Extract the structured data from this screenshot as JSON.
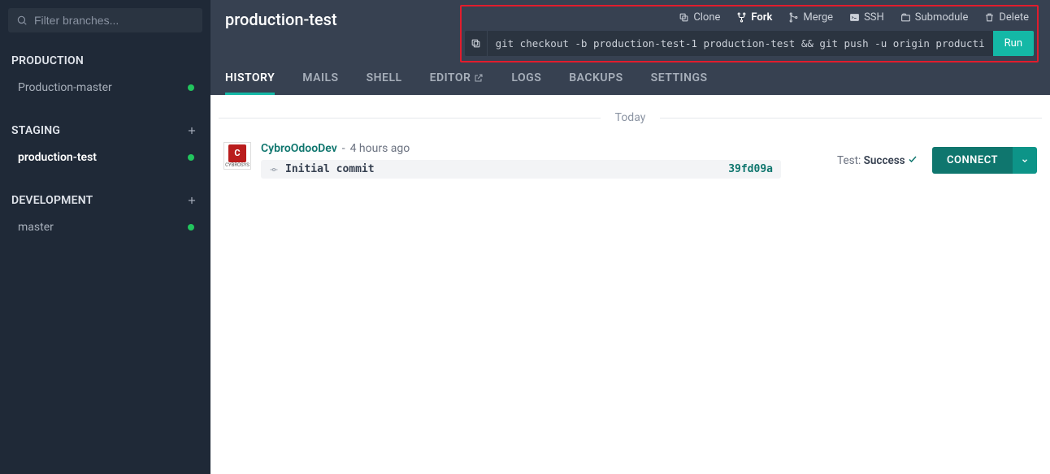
{
  "search": {
    "placeholder": "Filter branches..."
  },
  "sidebar": {
    "sections": [
      {
        "title": "PRODUCTION",
        "addable": false,
        "items": [
          {
            "name": "Production-master",
            "active": false
          }
        ]
      },
      {
        "title": "STAGING",
        "addable": true,
        "items": [
          {
            "name": "production-test",
            "active": true
          }
        ]
      },
      {
        "title": "DEVELOPMENT",
        "addable": true,
        "items": [
          {
            "name": "master",
            "active": false
          }
        ]
      }
    ]
  },
  "header": {
    "branch_title": "production-test",
    "actions": {
      "clone": "Clone",
      "fork": "Fork",
      "merge": "Merge",
      "ssh": "SSH",
      "submodule": "Submodule",
      "delete": "Delete"
    },
    "command": "git checkout -b production-test-1 production-test && git push -u origin producti",
    "run_label": "Run"
  },
  "tabs": [
    {
      "key": "history",
      "label": "HISTORY",
      "active": true
    },
    {
      "key": "mails",
      "label": "MAILS"
    },
    {
      "key": "shell",
      "label": "SHELL"
    },
    {
      "key": "editor",
      "label": "EDITOR",
      "ext": true
    },
    {
      "key": "logs",
      "label": "LOGS"
    },
    {
      "key": "backups",
      "label": "BACKUPS"
    },
    {
      "key": "settings",
      "label": "SETTINGS"
    }
  ],
  "history": {
    "group_label": "Today",
    "entries": [
      {
        "author": "CybroOdooDev",
        "time_ago": "4 hours ago",
        "avatar_text": "CYBROSYS",
        "commit_message": "Initial commit",
        "commit_hash": "39fd09a",
        "test_label": "Test:",
        "test_result": "Success",
        "connect_label": "CONNECT"
      }
    ]
  }
}
